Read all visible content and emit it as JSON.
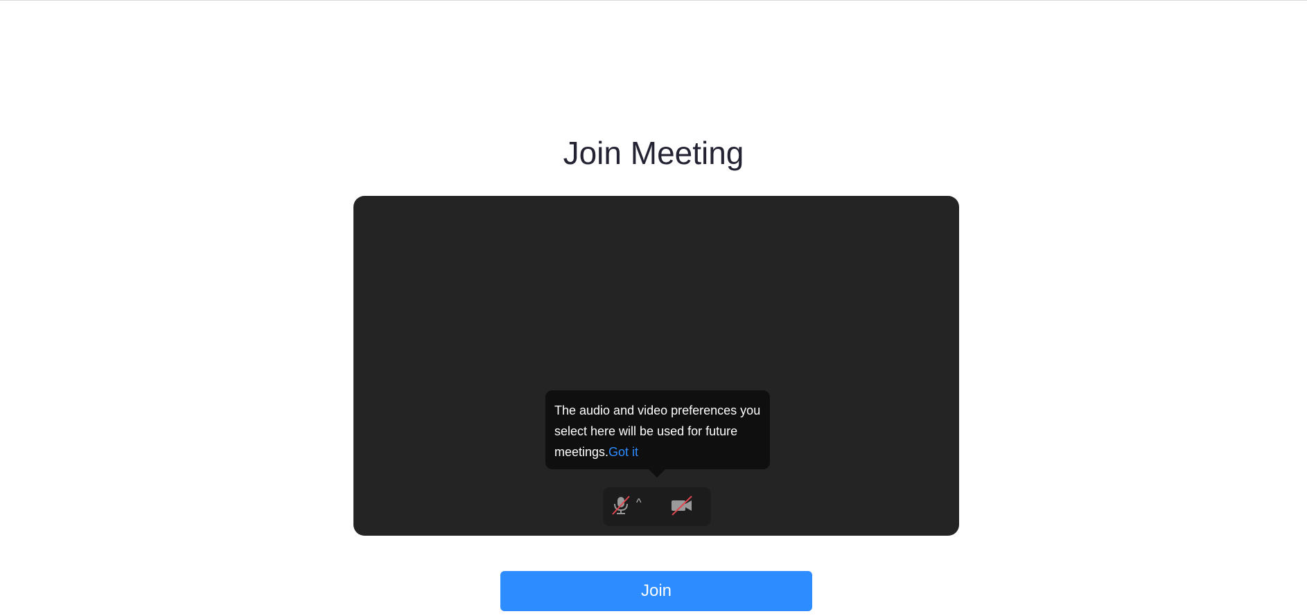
{
  "page": {
    "title": "Join Meeting"
  },
  "preview": {
    "tooltip": {
      "message": "The audio and video preferences you select here will be used for future meetings.",
      "link_label": "Got it"
    },
    "controls": {
      "audio_icon": "microphone-muted-icon",
      "audio_caret": "^",
      "video_icon": "video-off-icon"
    }
  },
  "join": {
    "label": "Join"
  },
  "colors": {
    "accent": "#2d8cff",
    "preview_bg": "#242424",
    "tooltip_bg": "#0f0f0f",
    "muted_slash": "#e0464f"
  }
}
